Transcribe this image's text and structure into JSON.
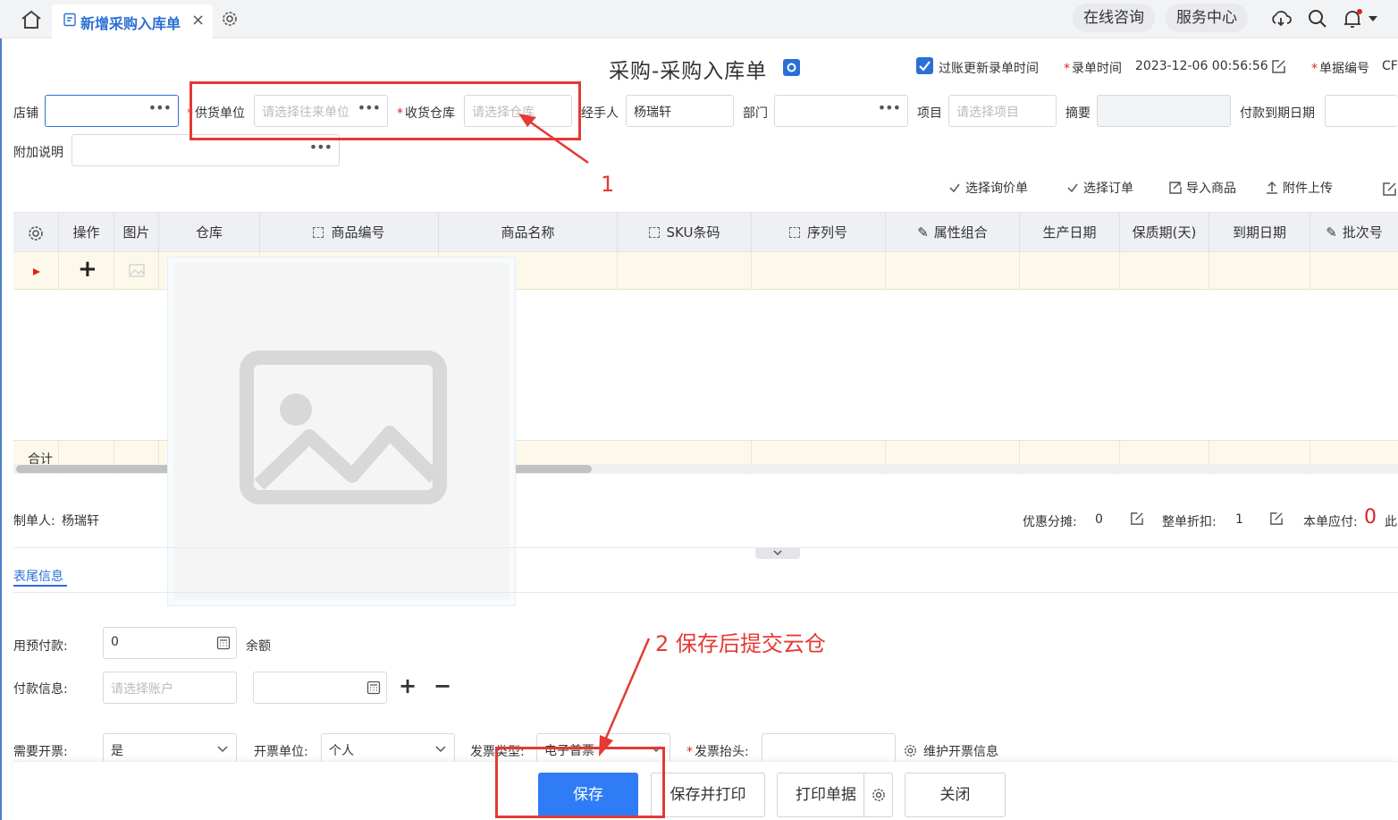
{
  "topbar": {
    "tab_title": "新增采购入库单",
    "tab_close": "×",
    "online_consult": "在线咨询",
    "service_center": "服务中心"
  },
  "header": {
    "title": "采购-采购入库单",
    "repost_update_label": "过账更新录单时间",
    "entry_time_label": "录单时间",
    "entry_time_value": "2023-12-06 00:56:56",
    "doc_no_label": "单据编号",
    "doc_no_value": "CF"
  },
  "form": {
    "shop_label": "店铺",
    "supplier_label": "供货单位",
    "supplier_placeholder": "请选择往来单位",
    "warehouse_label": "收货仓库",
    "warehouse_placeholder": "请选择仓库",
    "handler_label": "经手人",
    "handler_value": "杨瑞轩",
    "dept_label": "部门",
    "project_label": "项目",
    "project_placeholder": "请选择项目",
    "summary_label": "摘要",
    "due_date_label": "付款到期日期",
    "remark_label": "附加说明"
  },
  "toolbar": {
    "select_inquiry": "选择询价单",
    "select_order": "选择订单",
    "import_goods": "导入商品",
    "attach_upload": "附件上传"
  },
  "grid": {
    "columns": [
      "操作",
      "图片",
      "仓库",
      "商品编号",
      "商品名称",
      "SKU条码",
      "序列号",
      "属性组合",
      "生产日期",
      "保质期(天)",
      "到期日期",
      "批次号"
    ],
    "add_symbol": "+",
    "sum_label": "合计"
  },
  "footer_summary": {
    "creator_label": "制单人:",
    "creator_value": "杨瑞轩",
    "discount_share_label": "优惠分摊:",
    "discount_share_value": "0",
    "whole_discount_label": "整单折扣:",
    "whole_discount_value": "1",
    "payable_label": "本单应付:",
    "payable_value": "0",
    "payable_suffix": "此"
  },
  "tail": {
    "tab_label": "表尾信息",
    "prepay_label": "用预付款:",
    "prepay_value": "0",
    "balance_label": "余额",
    "payinfo_label": "付款信息:",
    "account_placeholder": "请选择账户",
    "plus": "+",
    "minus": "−",
    "need_invoice_label": "需要开票:",
    "need_invoice_value": "是",
    "invoice_unit_label": "开票单位:",
    "invoice_unit_value": "个人",
    "invoice_type_label": "发票类型:",
    "invoice_type_value": "电子普票",
    "invoice_title_label": "发票抬头:",
    "maintain_invoice": "维护开票信息"
  },
  "buttons": {
    "save": "保存",
    "save_print": "保存并打印",
    "print_doc": "打印单据",
    "close": "关闭"
  },
  "annotations": {
    "note1": "1",
    "note2": "2 保存后提交云仓"
  }
}
